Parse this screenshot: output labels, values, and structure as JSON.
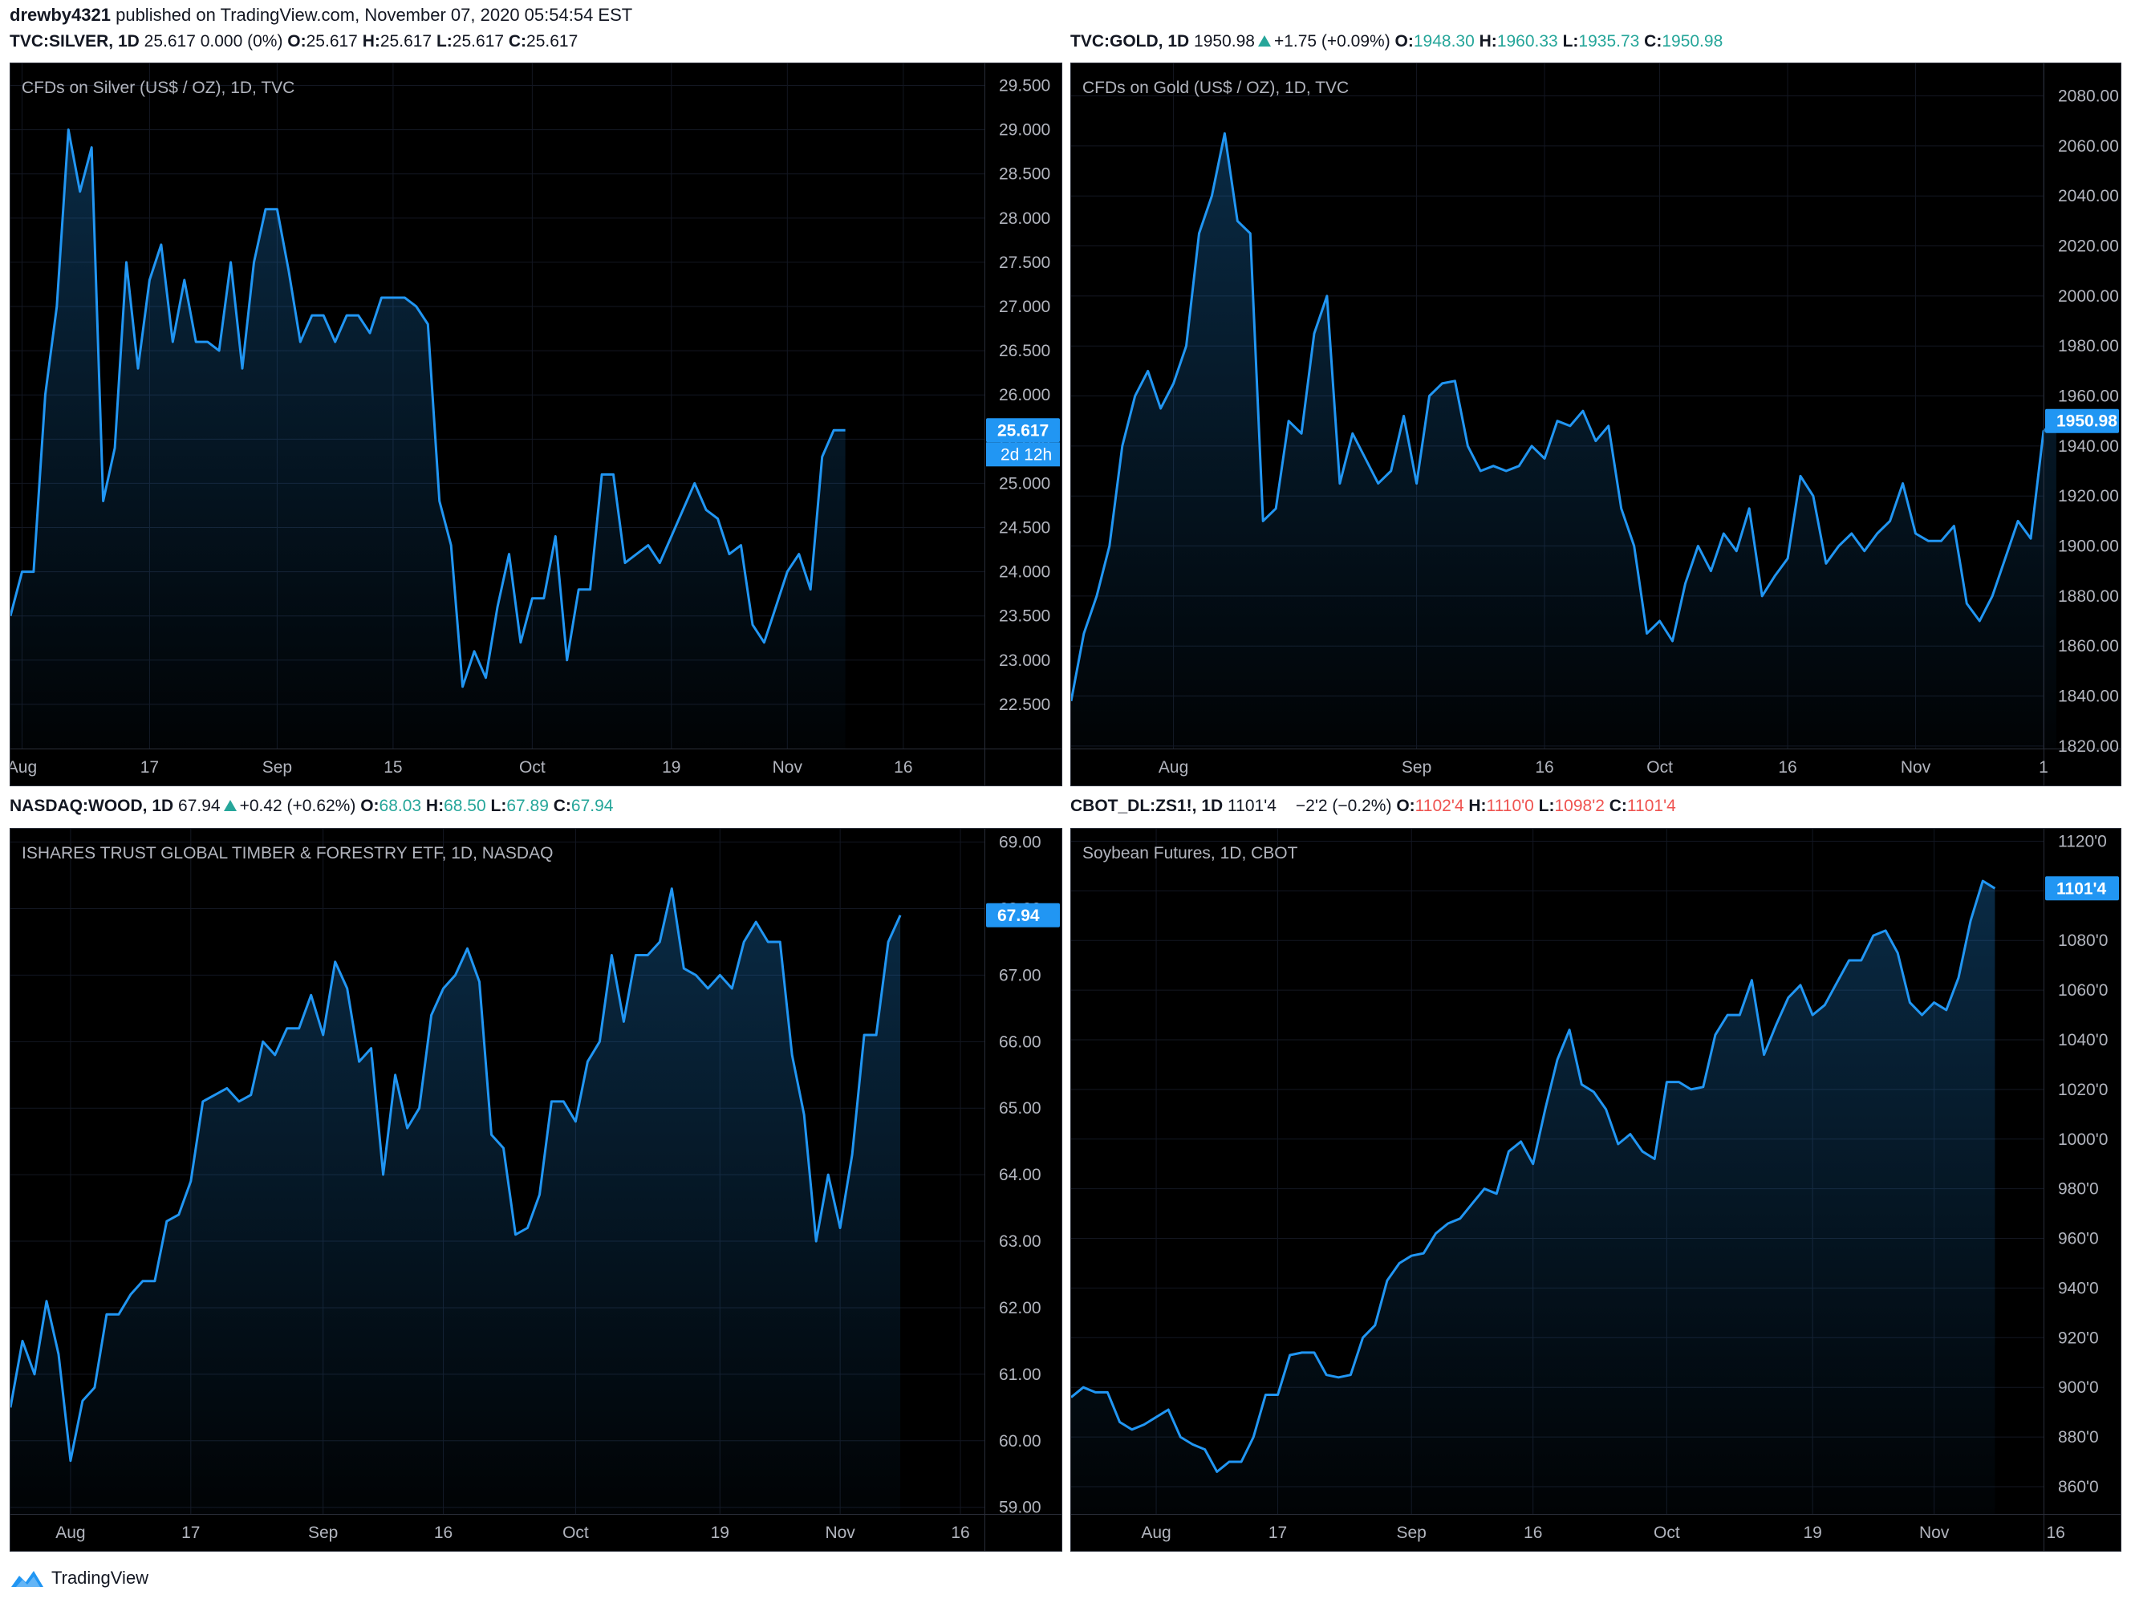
{
  "header": {
    "user": "drewby4321",
    "text": "published on TradingView.com, November 07, 2020 05:54:54 EST"
  },
  "footer": {
    "brand": "TradingView"
  },
  "colors": {
    "line": "#2196f3",
    "up": "#26a69a",
    "down": "#ef5350",
    "grid": "#1e222d",
    "axis_text": "#b2b5be",
    "background": "#000000"
  },
  "panels": [
    {
      "symbol": "TVC:SILVER, 1D",
      "last": "25.617",
      "change": "0.000 (0%)",
      "direction": "none",
      "o_label": "O:",
      "o": "25.617",
      "h_label": "H:",
      "h": "25.617",
      "l_label": "L:",
      "l": "25.617",
      "c_label": "C:",
      "c": "25.617",
      "value_color": "neutral",
      "title": "CFDs on Silver (US$ / OZ), 1D, TVC",
      "price_tag": "25.617",
      "countdown_tag": "2d 12h"
    },
    {
      "symbol": "TVC:GOLD, 1D",
      "last": "1950.98",
      "change": "+1.75 (+0.09%)",
      "direction": "up",
      "o_label": "O:",
      "o": "1948.30",
      "h_label": "H:",
      "h": "1960.33",
      "l_label": "L:",
      "l": "1935.73",
      "c_label": "C:",
      "c": "1950.98",
      "value_color": "up",
      "title": "CFDs on Gold (US$ / OZ), 1D, TVC",
      "price_tag": "1950.98",
      "countdown_tag": ""
    },
    {
      "symbol": "NASDAQ:WOOD, 1D",
      "last": "67.94",
      "change": "+0.42 (+0.62%)",
      "direction": "up",
      "o_label": "O:",
      "o": "68.03",
      "h_label": "H:",
      "h": "68.50",
      "l_label": "L:",
      "l": "67.89",
      "c_label": "C:",
      "c": "67.94",
      "value_color": "up",
      "title": "ISHARES TRUST GLOBAL TIMBER & FORESTRY ETF, 1D, NASDAQ",
      "price_tag": "67.94",
      "countdown_tag": ""
    },
    {
      "symbol": "CBOT_DL:ZS1!, 1D",
      "last": "1101'4",
      "change": "−2'2 (−0.2%)",
      "direction": "down",
      "o_label": "O:",
      "o": "1102'4",
      "h_label": "H:",
      "h": "1110'0",
      "l_label": "L:",
      "l": "1098'2",
      "c_label": "C:",
      "c": "1101'4",
      "value_color": "down",
      "title": "Soybean Futures, 1D, CBOT",
      "price_tag": "1101'4",
      "countdown_tag": ""
    }
  ],
  "chart_data": [
    {
      "type": "area",
      "title": "CFDs on Silver (US$ / OZ), 1D, TVC",
      "ylim": [
        22.0,
        29.75
      ],
      "y_ticks": [
        "22.500",
        "23.000",
        "23.500",
        "24.000",
        "24.500",
        "25.000",
        "25.500",
        "26.000",
        "26.500",
        "27.000",
        "27.500",
        "28.000",
        "28.500",
        "29.000",
        "29.500"
      ],
      "x_ticks": [
        {
          "label": "Aug",
          "x": 1
        },
        {
          "label": "17",
          "x": 12
        },
        {
          "label": "Sep",
          "x": 23
        },
        {
          "label": "15",
          "x": 33
        },
        {
          "label": "Oct",
          "x": 45
        },
        {
          "label": "19",
          "x": 57
        },
        {
          "label": "Nov",
          "x": 67
        },
        {
          "label": "16",
          "x": 77
        }
      ],
      "x_range": [
        0,
        84
      ],
      "series": [
        {
          "values": [
            23.5,
            24.0,
            24.0,
            26.0,
            27.0,
            29.0,
            28.3,
            28.8,
            24.8,
            25.4,
            27.5,
            26.3,
            27.3,
            27.7,
            26.6,
            27.3,
            26.6,
            26.6,
            26.5,
            27.5,
            26.3,
            27.5,
            28.1,
            28.1,
            27.4,
            26.6,
            26.9,
            26.9,
            26.6,
            26.9,
            26.9,
            26.7,
            27.1,
            27.1,
            27.1,
            27.0,
            26.8,
            24.8,
            24.3,
            22.7,
            23.1,
            22.8,
            23.6,
            24.2,
            23.2,
            23.7,
            23.7,
            24.4,
            23.0,
            23.8,
            23.8,
            25.1,
            25.1,
            24.1,
            24.2,
            24.3,
            24.1,
            24.4,
            24.7,
            25.0,
            24.7,
            24.6,
            24.2,
            24.3,
            23.4,
            23.2,
            23.6,
            24.0,
            24.2,
            23.8,
            25.3,
            25.6,
            25.6
          ]
        }
      ]
    },
    {
      "type": "area",
      "title": "CFDs on Gold (US$ / OZ), 1D, TVC",
      "ylim": [
        1819,
        2093
      ],
      "y_ticks": [
        "1820.00",
        "1840.00",
        "1860.00",
        "1880.00",
        "1900.00",
        "1920.00",
        "1940.00",
        "1960.00",
        "1980.00",
        "2000.00",
        "2020.00",
        "2040.00",
        "2060.00",
        "2080.00"
      ],
      "x_ticks": [
        {
          "label": "Aug",
          "x": 8
        },
        {
          "label": "Sep",
          "x": 27
        },
        {
          "label": "16",
          "x": 37
        },
        {
          "label": "Oct",
          "x": 46
        },
        {
          "label": "16",
          "x": 56
        },
        {
          "label": "Nov",
          "x": 66
        },
        {
          "label": "1",
          "x": 76
        }
      ],
      "x_range": [
        0,
        76
      ],
      "series": [
        {
          "values": [
            1838,
            1865,
            1880,
            1900,
            1940,
            1960,
            1970,
            1955,
            1965,
            1980,
            2025,
            2040,
            2065,
            2030,
            2025,
            1910,
            1915,
            1950,
            1945,
            1985,
            2000,
            1925,
            1945,
            1935,
            1925,
            1930,
            1952,
            1925,
            1960,
            1965,
            1966,
            1940,
            1930,
            1932,
            1930,
            1932,
            1940,
            1935,
            1950,
            1948,
            1954,
            1942,
            1948,
            1915,
            1900,
            1865,
            1870,
            1862,
            1885,
            1900,
            1890,
            1905,
            1898,
            1915,
            1880,
            1888,
            1895,
            1928,
            1920,
            1893,
            1900,
            1905,
            1898,
            1905,
            1910,
            1925,
            1905,
            1902,
            1902,
            1908,
            1877,
            1870,
            1880,
            1895,
            1910,
            1903,
            1946,
            1950
          ]
        }
      ]
    },
    {
      "type": "area",
      "title": "ISHARES TRUST GLOBAL TIMBER & FORESTRY ETF, 1D, NASDAQ",
      "ylim": [
        58.9,
        69.2
      ],
      "y_ticks": [
        "59.00",
        "60.00",
        "61.00",
        "62.00",
        "63.00",
        "64.00",
        "65.00",
        "66.00",
        "67.00",
        "68.00",
        "69.00"
      ],
      "x_ticks": [
        {
          "label": "Aug",
          "x": 5
        },
        {
          "label": "17",
          "x": 15
        },
        {
          "label": "Sep",
          "x": 26
        },
        {
          "label": "16",
          "x": 36
        },
        {
          "label": "Oct",
          "x": 47
        },
        {
          "label": "19",
          "x": 59
        },
        {
          "label": "Nov",
          "x": 69
        },
        {
          "label": "16",
          "x": 79
        }
      ],
      "x_range": [
        0,
        81
      ],
      "series": [
        {
          "values": [
            60.5,
            61.5,
            61.0,
            62.1,
            61.3,
            59.7,
            60.6,
            60.8,
            61.9,
            61.9,
            62.2,
            62.4,
            62.4,
            63.3,
            63.4,
            63.9,
            65.1,
            65.2,
            65.3,
            65.1,
            65.2,
            66.0,
            65.8,
            66.2,
            66.2,
            66.7,
            66.1,
            67.2,
            66.8,
            65.7,
            65.9,
            64.0,
            65.5,
            64.7,
            65.0,
            66.4,
            66.8,
            67.0,
            67.4,
            66.9,
            64.6,
            64.4,
            63.1,
            63.2,
            63.7,
            65.1,
            65.1,
            64.8,
            65.7,
            66.0,
            67.3,
            66.3,
            67.3,
            67.3,
            67.5,
            68.3,
            67.1,
            67.0,
            66.8,
            67.0,
            66.8,
            67.5,
            67.8,
            67.5,
            67.5,
            65.8,
            64.9,
            63.0,
            64.0,
            63.2,
            64.3,
            66.1,
            66.1,
            67.5,
            67.9
          ]
        }
      ]
    },
    {
      "type": "area",
      "title": "Soybean Futures, 1D, CBOT",
      "ylim": [
        849,
        1125
      ],
      "y_ticks": [
        "860'0",
        "880'0",
        "900'0",
        "920'0",
        "940'0",
        "960'0",
        "980'0",
        "1000'0",
        "1020'0",
        "1040'0",
        "1060'0",
        "1080'0",
        "1100'0",
        "1120'0"
      ],
      "x_ticks": [
        {
          "label": "Aug",
          "x": 7
        },
        {
          "label": "17",
          "x": 17
        },
        {
          "label": "Sep",
          "x": 28
        },
        {
          "label": "16",
          "x": 38
        },
        {
          "label": "Oct",
          "x": 49
        },
        {
          "label": "19",
          "x": 61
        },
        {
          "label": "Nov",
          "x": 71
        },
        {
          "label": "16",
          "x": 81
        }
      ],
      "x_range": [
        0,
        80
      ],
      "series": [
        {
          "values": [
            896,
            900,
            898,
            898,
            886,
            883,
            885,
            888,
            891,
            880,
            877,
            875,
            866,
            870,
            870,
            880,
            897,
            897,
            913,
            914,
            914,
            905,
            904,
            905,
            920,
            925,
            943,
            950,
            953,
            954,
            962,
            966,
            968,
            974,
            980,
            978,
            995,
            999,
            990,
            1012,
            1032,
            1044,
            1022,
            1019,
            1012,
            998,
            1002,
            995,
            992,
            1023,
            1023,
            1020,
            1021,
            1042,
            1050,
            1050,
            1064,
            1034,
            1046,
            1057,
            1062,
            1050,
            1054,
            1063,
            1072,
            1072,
            1082,
            1084,
            1075,
            1055,
            1050,
            1055,
            1052,
            1065,
            1088,
            1104,
            1101
          ]
        }
      ]
    }
  ]
}
